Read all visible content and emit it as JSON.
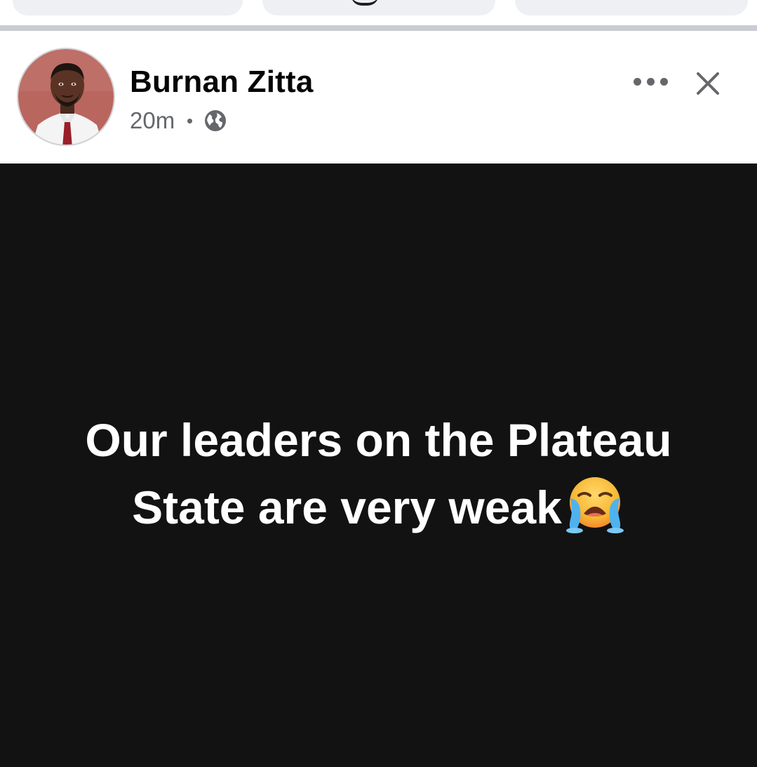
{
  "post": {
    "author_name": "Burnan Zitta",
    "timestamp": "20m",
    "privacy_icon": "globe-icon",
    "text_line_1": "Our leaders on the Plateau",
    "text_line_2": "State are very weak",
    "emoji": "loudly-crying-face-emoji",
    "background_color": "#121212",
    "text_color": "#ffffff"
  },
  "actions": {
    "more_icon": "more-horizontal-icon",
    "close_icon": "close-icon"
  }
}
